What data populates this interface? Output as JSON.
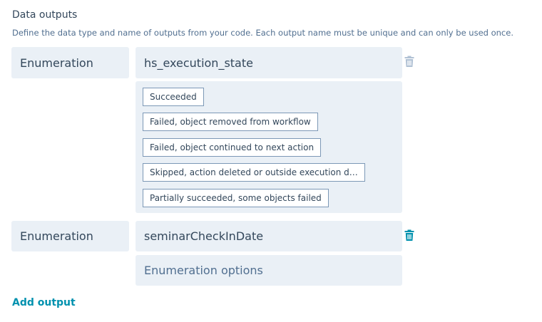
{
  "section": {
    "title": "Data outputs",
    "description": "Define the data type and name of outputs from your code. Each output name must be unique and can only be used once."
  },
  "outputs": [
    {
      "type": "Enumeration",
      "name": "hs_execution_state",
      "options": [
        "Succeeded",
        "Failed, object removed from workflow",
        "Failed, object continued to next action",
        "Skipped, action deleted or outside execution d…",
        "Partially succeeded, some objects failed"
      ],
      "delete_icon": "trash-icon",
      "delete_color": "#b0c1d4"
    },
    {
      "type": "Enumeration",
      "name": "seminarCheckInDate",
      "options_placeholder": "Enumeration options",
      "delete_icon": "trash-icon",
      "delete_color": "#0091ae"
    }
  ],
  "add_output_label": "Add output",
  "colors": {
    "accent": "#0091ae",
    "field_bg": "#eaf0f6",
    "text": "#33475b"
  }
}
